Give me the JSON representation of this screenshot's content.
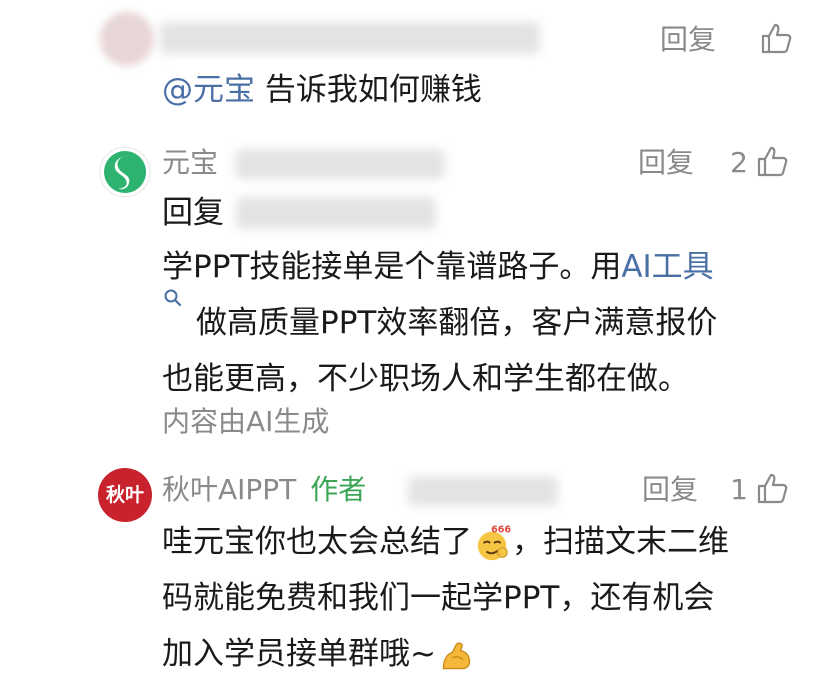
{
  "comments": [
    {
      "name": "",
      "reply_label": "回复",
      "like_count": "",
      "text": {
        "mention": "@元宝",
        "body": " 告诉我如何赚钱"
      }
    },
    {
      "name": "元宝",
      "reply_label": "回复",
      "like_count": "2",
      "reply_prefix": "回复",
      "lines": [
        "学PPT技能接单是个靠谱路子。用",
        "AI工具",
        "做高质量PPT效率翻倍，客户满意报价",
        "也能更高，不少职场人和学生都在做。"
      ],
      "ai_note": "内容由AI生成"
    },
    {
      "name": "秋叶AIPPT",
      "author_tag": "作者",
      "avatar_text": "秋叶",
      "reply_label": "回复",
      "like_count": "1",
      "lines": [
        "哇元宝你也太会总结了",
        "，扫描文末二维",
        "码就能免费和我们一起学PPT，还有机会",
        "加入学员接单群哦~"
      ]
    }
  ],
  "colors": {
    "meta_gray": "#8a8a8a",
    "link_blue": "#4a6fa5",
    "author_green": "#3aa655",
    "qiuye_red": "#c8232c",
    "yuanbao_green": "#2db36f"
  },
  "icons": {
    "like": "thumbs-up-icon",
    "search": "search-icon",
    "emoji_666": "smirk-666-emoji",
    "emoji_flex": "flexed-biceps-emoji"
  }
}
